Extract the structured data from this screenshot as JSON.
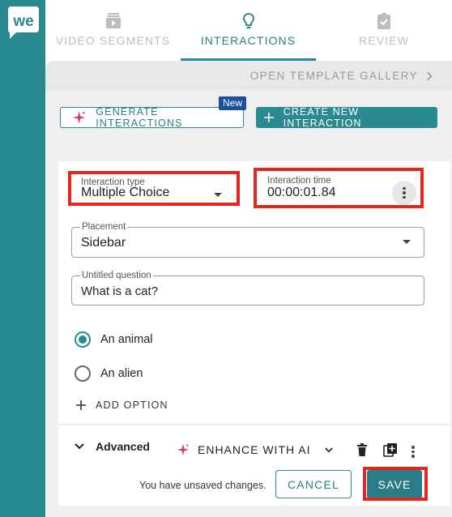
{
  "brand": {
    "logo_text": "we",
    "color": "#2a8a92"
  },
  "tabs": [
    {
      "label": "VIDEO SEGMENTS",
      "icon": "video-segments-icon",
      "active": false
    },
    {
      "label": "INTERACTIONS",
      "icon": "lightbulb-icon",
      "active": true
    },
    {
      "label": "REVIEW",
      "icon": "clipboard-check-icon",
      "active": false
    }
  ],
  "gallery": {
    "label": "OPEN TEMPLATE GALLERY"
  },
  "actions": {
    "generate_label": "GENERATE INTERACTIONS",
    "new_badge": "New",
    "create_label": "CREATE NEW INTERACTION"
  },
  "form": {
    "interaction_type": {
      "label": "Interaction type",
      "value": "Multiple Choice"
    },
    "interaction_time": {
      "label": "Interaction time",
      "value": "00:00:01.84"
    },
    "placement": {
      "label": "Placement",
      "value": "Sidebar"
    },
    "question": {
      "label": "Untitled question",
      "value": "What is a cat?"
    },
    "options": [
      {
        "label": "An animal",
        "selected": true
      },
      {
        "label": "An alien",
        "selected": false
      }
    ],
    "add_option_label": "ADD OPTION",
    "advanced_label": "Advanced",
    "enhance_label": "ENHANCE WITH AI",
    "unsaved_text": "You have unsaved changes.",
    "cancel_label": "CANCEL",
    "save_label": "SAVE"
  },
  "colors": {
    "accent": "#2a8a92",
    "highlight": "#e3271f",
    "badge": "#1d4fa0",
    "ai_sparkle": "#d6337a"
  }
}
